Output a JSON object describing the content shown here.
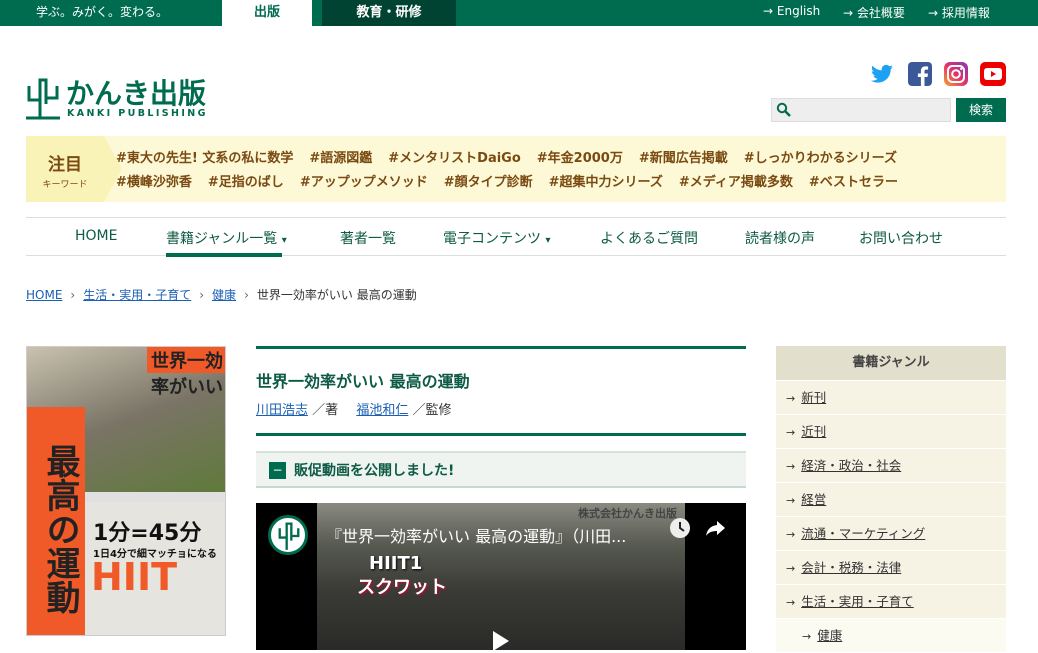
{
  "topbar": {
    "tagline": "学ぶ。みがく。変わる。",
    "tabs": [
      {
        "label": "出版",
        "active": true
      },
      {
        "label": "教育・研修",
        "active": false
      }
    ],
    "links": [
      "English",
      "会社概要",
      "採用情報"
    ],
    "link_icon": "→"
  },
  "brand": {
    "name": "かんき出版",
    "sub": "KANKI PUBLISHING",
    "color": "#006c4f"
  },
  "social": [
    "twitter",
    "facebook",
    "instagram",
    "youtube"
  ],
  "search": {
    "placeholder": "",
    "value": "",
    "button": "検索"
  },
  "keywords": {
    "label": "注目",
    "sublabel": "キーワード",
    "row1": [
      "#東大の先生! 文系の私に数学",
      "#語源図鑑",
      "#メンタリストDaiGo",
      "#年金2000万",
      "#新聞広告掲載",
      "#しっかりわかるシリーズ"
    ],
    "row2": [
      "#横峰沙弥香",
      "#足指のばし",
      "#アップップメソッド",
      "#顔タイプ診断",
      "#超集中力シリーズ",
      "#メディア掲載多数",
      "#ベストセラー"
    ]
  },
  "nav": [
    {
      "label": "HOME"
    },
    {
      "label": "書籍ジャンル一覧",
      "dropdown": "▾",
      "active": true
    },
    {
      "label": "著者一覧"
    },
    {
      "label": "電子コンテンツ",
      "dropdown": "▾"
    },
    {
      "label": "よくあるご質問"
    },
    {
      "label": "読者様の声"
    },
    {
      "label": "お問い合わせ"
    }
  ],
  "breadcrumb": [
    "HOME",
    "生活・実用・子育て",
    "健康",
    "世界一効率がいい 最高の運動"
  ],
  "breadcrumb_sep": "›",
  "book": {
    "title": "世界一効率がいい 最高の運動",
    "author": "川田浩志",
    "author_role": "／著",
    "supervisor": "福池和仁",
    "supervisor_role": "／監修",
    "cover": {
      "title_top": "世界一効率がいい",
      "title_main": "最高の運動",
      "headline": "1分=45分",
      "sub": "1日4分で細マッチョになる",
      "big": "HIIT"
    }
  },
  "promo": {
    "toggle": "−",
    "text": "販促動画を公開しました!"
  },
  "video": {
    "title": "『世界一効率がいい 最高の運動』（川田...",
    "watermark": "株式会社かんき出版",
    "caption1": "HIIT1",
    "caption2": "スクワット"
  },
  "sidebar": {
    "heading": "書籍ジャンル",
    "items": [
      "新刊",
      "近刊",
      "経済・政治・社会",
      "経営",
      "流通・マーケティング",
      "会計・税務・法律",
      "生活・実用・子育て"
    ],
    "sub_items": [
      "健康"
    ],
    "arrow": "→"
  }
}
